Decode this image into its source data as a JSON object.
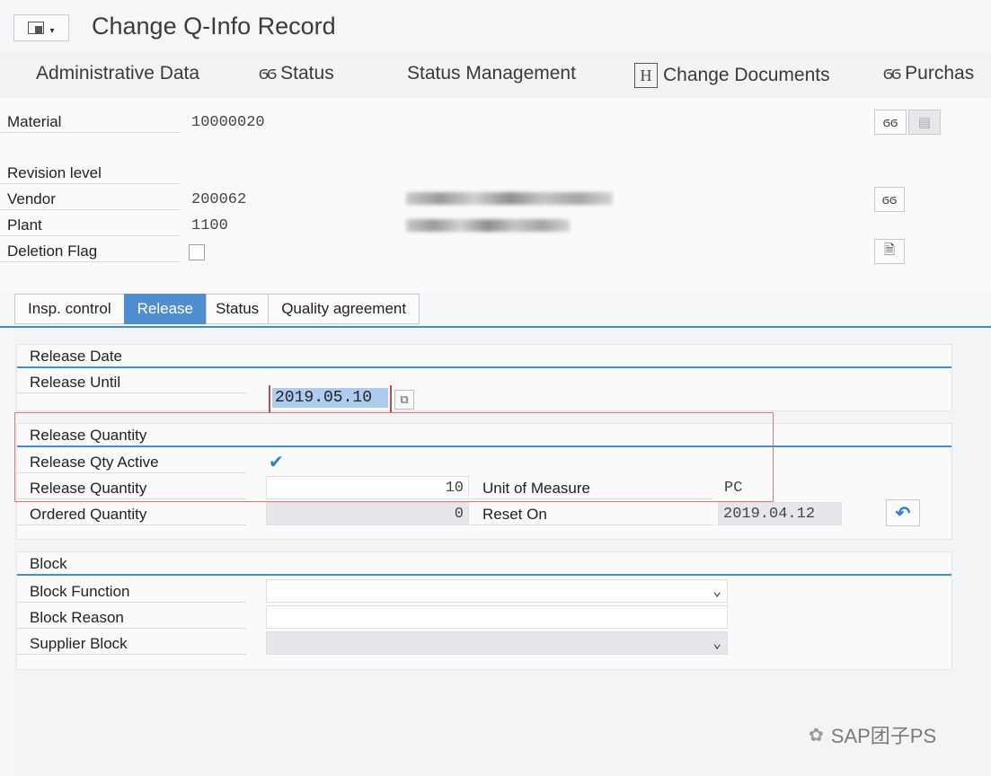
{
  "window": {
    "title": "Change Q-Info Record"
  },
  "toolbar": {
    "items": [
      {
        "label": "Administrative Data",
        "icon": ""
      },
      {
        "label": "Status",
        "icon": "glasses-icon"
      },
      {
        "label": "Status Management",
        "icon": ""
      },
      {
        "label": "Change Documents",
        "icon": "h-icon"
      },
      {
        "label": "Purchas",
        "icon": "glasses-icon"
      }
    ]
  },
  "header": {
    "material": {
      "label": "Material",
      "value": "10000020"
    },
    "revision": {
      "label": "Revision level",
      "value": ""
    },
    "vendor": {
      "label": "Vendor",
      "value": "200062"
    },
    "plant": {
      "label": "Plant",
      "value": "1100"
    },
    "deletion": {
      "label": "Deletion Flag",
      "checked": false
    }
  },
  "tabs": [
    {
      "label": "Insp. control",
      "active": false
    },
    {
      "label": "Release",
      "active": true
    },
    {
      "label": "Status",
      "active": false
    },
    {
      "label": "Quality agreement",
      "active": false
    }
  ],
  "release_date": {
    "title": "Release Date",
    "until_label": "Release Until",
    "until_value": "2019.05.10"
  },
  "release_quantity": {
    "title": "Release Quantity",
    "active_label": "Release Qty Active",
    "active_checked": true,
    "qty_label": "Release Quantity",
    "qty_value": "10",
    "uom_label": "Unit of Measure",
    "uom_value": "PC",
    "ordered_label": "Ordered Quantity",
    "ordered_value": "0",
    "reset_label": "Reset On",
    "reset_value": "2019.04.12"
  },
  "block": {
    "title": "Block",
    "function_label": "Block Function",
    "function_value": "",
    "reason_label": "Block Reason",
    "reason_value": "",
    "supplier_label": "Supplier Block",
    "supplier_value": ""
  },
  "watermark": {
    "text": "SAP团子PS"
  },
  "colors": {
    "accent": "#3c8ed6",
    "tab_active": "#4f8ed0",
    "highlight": "#e07676"
  }
}
